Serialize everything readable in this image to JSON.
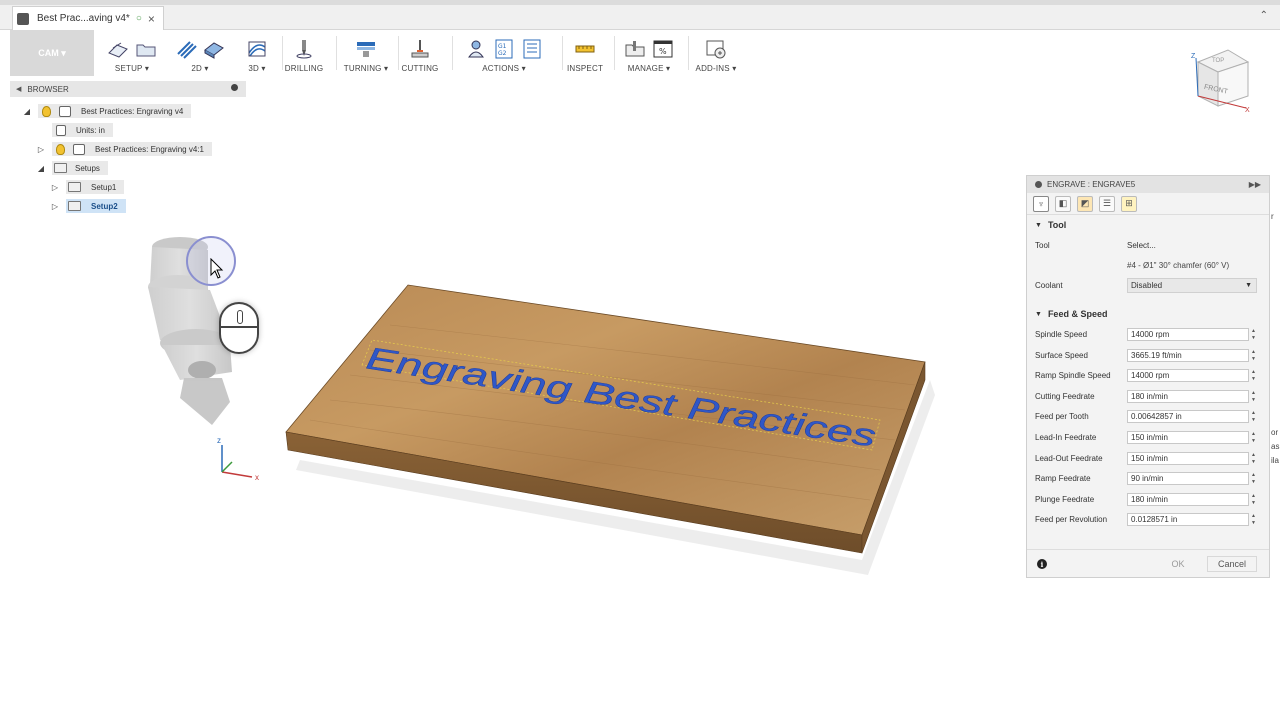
{
  "window": {
    "tab_title": "Best Prac...aving v4*",
    "tab_close": "×"
  },
  "toolbar": {
    "workspace": "CAM ▾",
    "groups": [
      "SETUP ▾",
      "2D ▾",
      "3D ▾",
      "DRILLING",
      "TURNING ▾",
      "CUTTING",
      "ACTIONS ▾",
      "INSPECT",
      "MANAGE ▾",
      "ADD-INS ▾"
    ]
  },
  "browser": {
    "title": "BROWSER",
    "items": [
      {
        "label": "Best Practices: Engraving v4"
      },
      {
        "label": "Units: in"
      },
      {
        "label": "Best Practices: Engraving v4:1"
      },
      {
        "label": "Setups"
      },
      {
        "label": "Setup1"
      },
      {
        "label": "Setup2"
      }
    ]
  },
  "viewport": {
    "engraved_text": "Engraving Best Practices",
    "viewcube_top": "TOP",
    "viewcube_front": "FRONT",
    "axis_z": "Z",
    "axis_x": "X",
    "triad_z": "z",
    "triad_x": "x"
  },
  "dialog": {
    "title": "ENGRAVE : ENGRAVE5",
    "tool_section": "Tool",
    "tool_label": "Tool",
    "tool_select": "Select...",
    "tool_name": "#4 - Ø1\" 30° chamfer (60° V)",
    "coolant_label": "Coolant",
    "coolant_value": "Disabled",
    "feed_section": "Feed & Speed",
    "params": [
      {
        "label": "Spindle Speed",
        "value": "14000 rpm"
      },
      {
        "label": "Surface Speed",
        "value": "3665.19 ft/min"
      },
      {
        "label": "Ramp Spindle Speed",
        "value": "14000 rpm"
      },
      {
        "label": "Cutting Feedrate",
        "value": "180 in/min"
      },
      {
        "label": "Feed per Tooth",
        "value": "0.00642857 in"
      },
      {
        "label": "Lead-In Feedrate",
        "value": "150 in/min"
      },
      {
        "label": "Lead-Out Feedrate",
        "value": "150 in/min"
      },
      {
        "label": "Ramp Feedrate",
        "value": "90 in/min"
      },
      {
        "label": "Plunge Feedrate",
        "value": "180 in/min"
      },
      {
        "label": "Feed per Revolution",
        "value": "0.0128571 in"
      }
    ],
    "ok": "OK",
    "cancel": "Cancel"
  },
  "edge_fragments": [
    "r",
    "or",
    "as",
    "ila"
  ],
  "colors": {
    "wood": "#b98a55",
    "engrave_text": "#2f57c8",
    "selection": "#cfe3f6"
  }
}
